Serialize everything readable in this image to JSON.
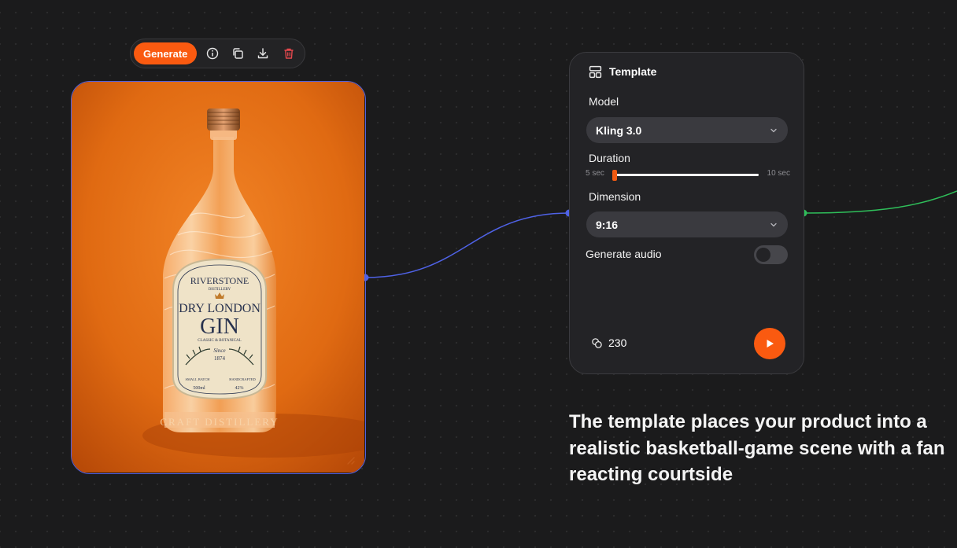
{
  "toolbar": {
    "generate_label": "Generate",
    "icons": [
      "info-icon",
      "copy-icon",
      "download-icon",
      "trash-icon"
    ]
  },
  "image_card": {
    "label": {
      "brand": "RIVERSTONE",
      "sub": "DISTILLERY",
      "line1": "DRY LONDON",
      "line2": "GIN",
      "tagline": "CLASSIC & BOTANICAL",
      "since": "Since",
      "year": "1874",
      "small_batch": "SMALL BATCH",
      "handcrafted": "HANDCRAFTED",
      "volume": "500ml",
      "abv": "42%",
      "embossed": "CRAFT DISTILLERY"
    }
  },
  "panel": {
    "title": "Template",
    "model_label": "Model",
    "model_value": "Kling 3.0",
    "duration_label": "Duration",
    "duration_min": "5 sec",
    "duration_max": "10 sec",
    "duration_fraction": 0.0,
    "dimension_label": "Dimension",
    "dimension_value": "9:16",
    "audio_label": "Generate audio",
    "audio_enabled": false,
    "credits": "230"
  },
  "caption": "The template places your product into a realistic basketball-game scene with a fan reacting courtside",
  "colors": {
    "accent": "#fa5a10",
    "input_wire": "#4f62e6",
    "output_wire": "#2fbf5a",
    "background": "#1b1b1c"
  }
}
